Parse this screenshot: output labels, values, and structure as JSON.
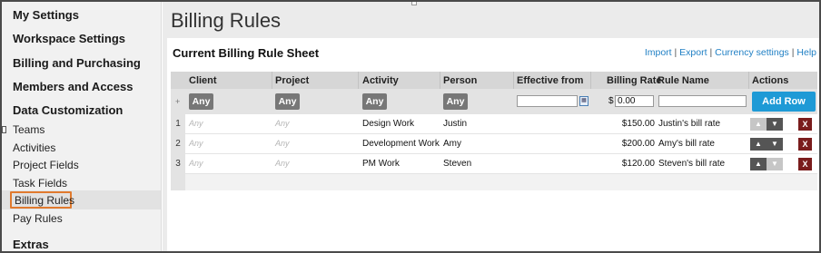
{
  "sidebar": {
    "sections": [
      {
        "label": "My Settings"
      },
      {
        "label": "Workspace Settings"
      },
      {
        "label": "Billing and Purchasing"
      },
      {
        "label": "Members and Access"
      },
      {
        "label": "Data Customization"
      },
      {
        "label": "Extras"
      }
    ],
    "items": [
      {
        "label": "Teams"
      },
      {
        "label": "Activities"
      },
      {
        "label": "Project Fields"
      },
      {
        "label": "Task Fields"
      },
      {
        "label": "Billing Rules"
      },
      {
        "label": "Pay Rules"
      }
    ],
    "active_item": "Billing Rules",
    "highlight_color": "#e07a2e"
  },
  "page": {
    "title": "Billing Rules",
    "sheet_title": "Current Billing Rule Sheet",
    "links": {
      "import": "Import",
      "export": "Export",
      "currency": "Currency settings",
      "help": "Help",
      "sep": "|"
    }
  },
  "table": {
    "headers": {
      "client": "Client",
      "project": "Project",
      "activity": "Activity",
      "person": "Person",
      "effective_from": "Effective from",
      "billing_rate": "Billing Rate",
      "rule_name": "Rule Name",
      "actions": "Actions"
    },
    "filter": {
      "plus": "+",
      "any_label": "Any",
      "currency_symbol": "$",
      "rate_value": "0.00",
      "calendar_icon": "calendar-icon",
      "add_row_label": "Add Row",
      "add_row_color": "#1e9ad6"
    },
    "rows": [
      {
        "num": "1",
        "client": "Any",
        "project": "Any",
        "activity": "Design Work",
        "person": "Justin",
        "rate": "$150.00",
        "rule_name": "Justin's bill rate",
        "up_enabled": false,
        "down_enabled": true,
        "delete": "X"
      },
      {
        "num": "2",
        "client": "Any",
        "project": "Any",
        "activity": "Development Work",
        "person": "Amy",
        "rate": "$200.00",
        "rule_name": "Amy's bill rate",
        "up_enabled": true,
        "down_enabled": true,
        "delete": "X"
      },
      {
        "num": "3",
        "client": "Any",
        "project": "Any",
        "activity": "PM Work",
        "person": "Steven",
        "rate": "$120.00",
        "rule_name": "Steven's bill rate",
        "up_enabled": true,
        "down_enabled": false,
        "delete": "X"
      }
    ]
  }
}
